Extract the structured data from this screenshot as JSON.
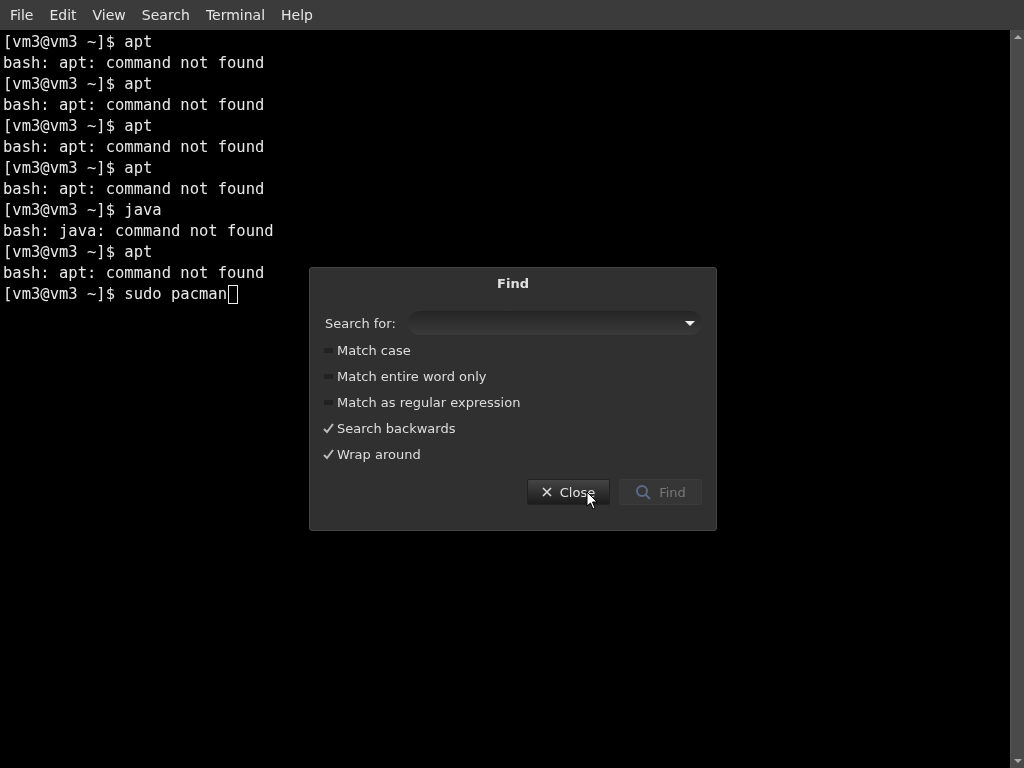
{
  "menu_bar": {
    "items": [
      "File",
      "Edit",
      "View",
      "Search",
      "Terminal",
      "Help"
    ]
  },
  "terminal": {
    "lines": [
      "[vm3@vm3 ~]$ apt",
      "bash: apt: command not found",
      "[vm3@vm3 ~]$ apt",
      "bash: apt: command not found",
      "[vm3@vm3 ~]$ apt",
      "bash: apt: command not found",
      "[vm3@vm3 ~]$ apt",
      "bash: apt: command not found",
      "[vm3@vm3 ~]$ java",
      "bash: java: command not found",
      "[vm3@vm3 ~]$ apt",
      "bash: apt: command not found",
      "[vm3@vm3 ~]$ sudo pacman"
    ]
  },
  "find_dialog": {
    "title": "Find",
    "search_label": "Search for:",
    "options": [
      {
        "label": "Match case",
        "checked": false
      },
      {
        "label": "Match entire word only",
        "checked": false
      },
      {
        "label": "Match as regular expression",
        "checked": false
      },
      {
        "label": "Search backwards",
        "checked": true
      },
      {
        "label": "Wrap around",
        "checked": true
      }
    ],
    "buttons": [
      {
        "label": "Close",
        "kind": "close",
        "disabled": false
      },
      {
        "label": "Find",
        "kind": "find",
        "disabled": true
      }
    ]
  }
}
